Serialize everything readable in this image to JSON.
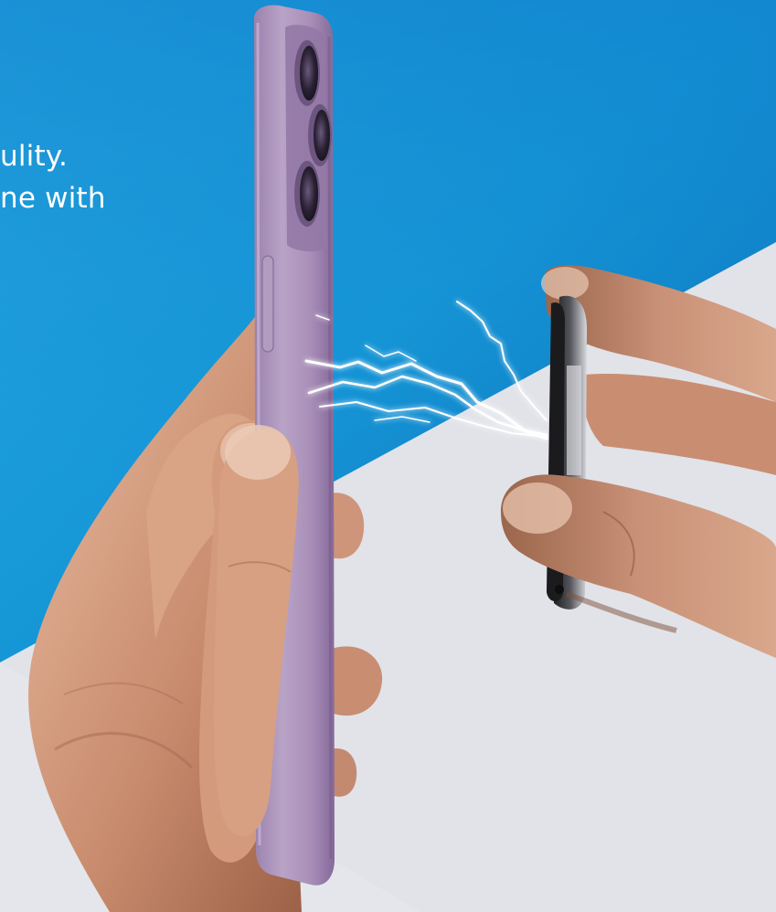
{
  "image": {
    "description_text": {
      "line_1": "ulity.",
      "line_2": "ne with"
    },
    "colors": {
      "background_blue_top": "#0b6fc3",
      "background_blue_mid": "#1596d6",
      "background_blue_light": "#2db2e6",
      "background_white": "#e4e6eb",
      "phone_body": "#a78fb6",
      "phone_edge": "#8c739e",
      "ring_metal": "#2b2b2e",
      "skin_light": "#e0b194",
      "skin_dark": "#8c5a43",
      "lightning": "#ffffff"
    },
    "objects": [
      "phone-side-view",
      "camera-lenses",
      "left-hand",
      "right-hand",
      "magnetic-ring",
      "lightning-effect"
    ]
  }
}
